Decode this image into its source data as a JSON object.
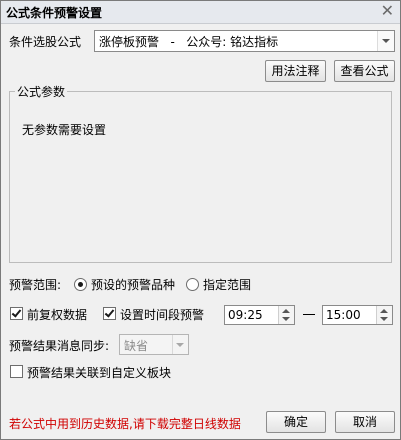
{
  "window": {
    "title": "公式条件预警设置"
  },
  "formula": {
    "label": "条件选股公式",
    "selected": "涨停板预警   -   公众号: 铭达指标"
  },
  "buttons": {
    "usage": "用法注释",
    "view": "查看公式",
    "ok": "确定",
    "cancel": "取消"
  },
  "params": {
    "group_title": "公式参数",
    "message": "无参数需要设置"
  },
  "range": {
    "label": "预警范围:",
    "options": [
      {
        "label": "预设的预警品种",
        "selected": true
      },
      {
        "label": "指定范围",
        "selected": false
      }
    ]
  },
  "options": {
    "adjust_label": "前复权数据",
    "adjust_checked": true,
    "time_label": "设置时间段预警",
    "time_checked": true,
    "start_time": "09:25",
    "end_time": "15:00",
    "sync_label": "预警结果消息同步:",
    "sync_value": "缺省",
    "link_label": "预警结果关联到自定义板块",
    "link_checked": false
  },
  "footer": {
    "warning": "若公式中用到历史数据,请下载完整日线数据"
  }
}
